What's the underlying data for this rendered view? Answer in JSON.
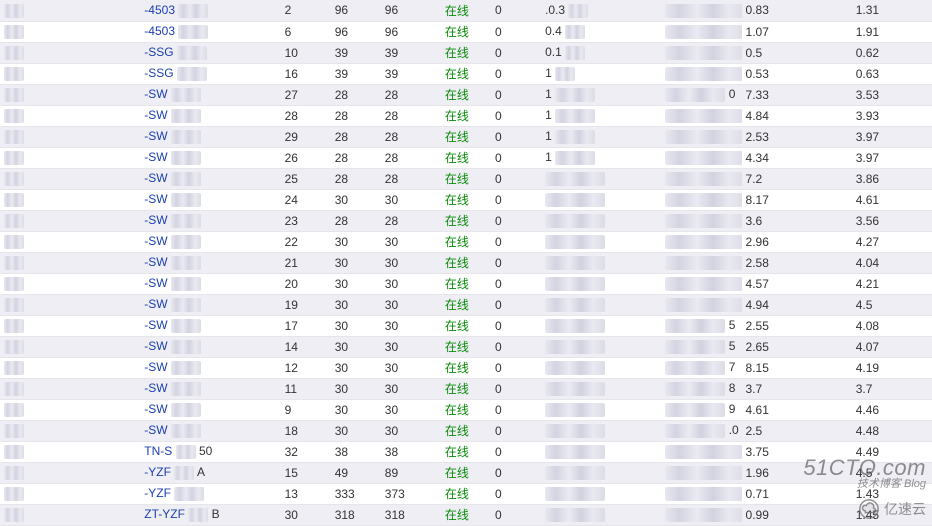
{
  "status_label": "在线",
  "watermarks": {
    "cto_big": "51CTO.com",
    "cto_small": "技术博客  Blog",
    "yisu": "亿速云"
  },
  "rows": [
    {
      "name_vis": "-4503",
      "name_blur_w": "w30",
      "c2": "2",
      "c3": "96",
      "c4": "96",
      "c6": "0",
      "c7_vis": ".0.3",
      "c7_blur_w": "w20",
      "c8_vis": "",
      "c8_blur_w": "w80",
      "c9": "0.83",
      "c10": "1.31"
    },
    {
      "name_vis": "-4503",
      "name_blur_w": "w30",
      "c2": "6",
      "c3": "96",
      "c4": "96",
      "c6": "0",
      "c7_vis": "0.4",
      "c7_blur_w": "w20",
      "c8_vis": "",
      "c8_blur_w": "w80",
      "c9": "1.07",
      "c10": "1.91"
    },
    {
      "name_vis": "-SSG",
      "name_blur_w": "w30",
      "c2": "10",
      "c3": "39",
      "c4": "39",
      "c6": "0",
      "c7_vis": "0.1",
      "c7_blur_w": "w20",
      "c8_vis": "",
      "c8_blur_w": "w80",
      "c9": "0.5",
      "c10": "0.62"
    },
    {
      "name_vis": "-SSG",
      "name_blur_w": "w30",
      "c2": "16",
      "c3": "39",
      "c4": "39",
      "c6": "0",
      "c7_vis": "1",
      "c7_blur_w": "w20",
      "c8_vis": "",
      "c8_blur_w": "w80",
      "c9": "0.53",
      "c10": "0.63"
    },
    {
      "name_vis": "-SW",
      "name_blur_w": "w30",
      "c2": "27",
      "c3": "28",
      "c4": "28",
      "c6": "0",
      "c7_vis": "1",
      "c7_blur_w": "w40",
      "c8_vis": "0",
      "c8_blur_w": "w60",
      "c9": "7.33",
      "c10": "3.53"
    },
    {
      "name_vis": "-SW",
      "name_blur_w": "w30",
      "c2": "28",
      "c3": "28",
      "c4": "28",
      "c6": "0",
      "c7_vis": "1",
      "c7_blur_w": "w40",
      "c8_vis": "",
      "c8_blur_w": "w80",
      "c9": "4.84",
      "c10": "3.93"
    },
    {
      "name_vis": "-SW",
      "name_blur_w": "w30",
      "c2": "29",
      "c3": "28",
      "c4": "28",
      "c6": "0",
      "c7_vis": "1",
      "c7_blur_w": "w40",
      "c8_vis": "",
      "c8_blur_w": "w80",
      "c9": "2.53",
      "c10": "3.97"
    },
    {
      "name_vis": "-SW",
      "name_blur_w": "w30",
      "c2": "26",
      "c3": "28",
      "c4": "28",
      "c6": "0",
      "c7_vis": "1",
      "c7_blur_w": "w40",
      "c8_vis": "",
      "c8_blur_w": "w80",
      "c9": "4.34",
      "c10": "3.97"
    },
    {
      "name_vis": "-SW",
      "name_blur_w": "w30",
      "c2": "25",
      "c3": "28",
      "c4": "28",
      "c6": "0",
      "c7_vis": "",
      "c7_blur_w": "w60",
      "c8_vis": "",
      "c8_blur_w": "w80",
      "c9": "7.2",
      "c10": "3.86"
    },
    {
      "name_vis": "-SW",
      "name_blur_w": "w30",
      "c2": "24",
      "c3": "30",
      "c4": "30",
      "c6": "0",
      "c7_vis": "",
      "c7_blur_w": "w60",
      "c8_vis": "",
      "c8_blur_w": "w80",
      "c9": "8.17",
      "c10": "4.61"
    },
    {
      "name_vis": "-SW",
      "name_blur_w": "w30",
      "c2": "23",
      "c3": "28",
      "c4": "28",
      "c6": "0",
      "c7_vis": "",
      "c7_blur_w": "w60",
      "c8_vis": "",
      "c8_blur_w": "w80",
      "c9": "3.6",
      "c10": "3.56"
    },
    {
      "name_vis": "-SW",
      "name_blur_w": "w30",
      "c2": "22",
      "c3": "30",
      "c4": "30",
      "c6": "0",
      "c7_vis": "",
      "c7_blur_w": "w60",
      "c8_vis": "",
      "c8_blur_w": "w80",
      "c9": "2.96",
      "c10": "4.27"
    },
    {
      "name_vis": "-SW",
      "name_blur_w": "w30",
      "c2": "21",
      "c3": "30",
      "c4": "30",
      "c6": "0",
      "c7_vis": "",
      "c7_blur_w": "w60",
      "c8_vis": "",
      "c8_blur_w": "w80",
      "c9": "2.58",
      "c10": "4.04"
    },
    {
      "name_vis": "-SW",
      "name_blur_w": "w30",
      "c2": "20",
      "c3": "30",
      "c4": "30",
      "c6": "0",
      "c7_vis": "",
      "c7_blur_w": "w60",
      "c8_vis": "",
      "c8_blur_w": "w80",
      "c9": "4.57",
      "c10": "4.21"
    },
    {
      "name_vis": "-SW",
      "name_blur_w": "w30",
      "c2": "19",
      "c3": "30",
      "c4": "30",
      "c6": "0",
      "c7_vis": "",
      "c7_blur_w": "w60",
      "c8_vis": "",
      "c8_blur_w": "w80",
      "c9": "4.94",
      "c10": "4.5"
    },
    {
      "name_vis": "-SW",
      "name_blur_w": "w30",
      "c2": "17",
      "c3": "30",
      "c4": "30",
      "c6": "0",
      "c7_vis": "",
      "c7_blur_w": "w60",
      "c8_vis": "5",
      "c8_blur_w": "w60",
      "c9": "2.55",
      "c10": "4.08"
    },
    {
      "name_vis": "-SW",
      "name_blur_w": "w30",
      "c2": "14",
      "c3": "30",
      "c4": "30",
      "c6": "0",
      "c7_vis": "",
      "c7_blur_w": "w60",
      "c8_vis": "5",
      "c8_blur_w": "w60",
      "c9": "2.65",
      "c10": "4.07"
    },
    {
      "name_vis": "-SW",
      "name_blur_w": "w30",
      "c2": "12",
      "c3": "30",
      "c4": "30",
      "c6": "0",
      "c7_vis": "",
      "c7_blur_w": "w60",
      "c8_vis": "7",
      "c8_blur_w": "w60",
      "c9": "8.15",
      "c10": "4.19"
    },
    {
      "name_vis": "-SW",
      "name_blur_w": "w30",
      "c2": "11",
      "c3": "30",
      "c4": "30",
      "c6": "0",
      "c7_vis": "",
      "c7_blur_w": "w60",
      "c8_vis": "8",
      "c8_blur_w": "w60",
      "c9": "3.7",
      "c10": "3.7"
    },
    {
      "name_vis": "-SW",
      "name_blur_w": "w30",
      "c2": "9",
      "c3": "30",
      "c4": "30",
      "c6": "0",
      "c7_vis": "",
      "c7_blur_w": "w60",
      "c8_vis": "9",
      "c8_blur_w": "w60",
      "c9": "4.61",
      "c10": "4.46"
    },
    {
      "name_vis": "-SW",
      "name_blur_w": "w30",
      "c2": "18",
      "c3": "30",
      "c4": "30",
      "c6": "0",
      "c7_vis": "",
      "c7_blur_w": "w60",
      "c8_vis": ".0",
      "c8_blur_w": "w60",
      "c9": "2.5",
      "c10": "4.48"
    },
    {
      "name_vis": "TN-S",
      "name_blur_w": "w20",
      "name_suffix": "50",
      "c2": "32",
      "c3": "38",
      "c4": "38",
      "c6": "0",
      "c7_vis": "",
      "c7_blur_w": "w60",
      "c8_vis": "",
      "c8_blur_w": "w80",
      "c9": "3.75",
      "c10": "4.49"
    },
    {
      "name_vis": "-YZF",
      "name_blur_w": "w20",
      "name_suffix": "A",
      "c2": "15",
      "c3": "49",
      "c4": "89",
      "c6": "0",
      "c7_vis": "",
      "c7_blur_w": "w60",
      "c8_vis": "",
      "c8_blur_w": "w80",
      "c9": "1.96",
      "c10": "4.5"
    },
    {
      "name_vis": "-YZF",
      "name_blur_w": "w30",
      "c2": "13",
      "c3": "333",
      "c4": "373",
      "c6": "0",
      "c7_vis": "",
      "c7_blur_w": "w60",
      "c8_vis": "",
      "c8_blur_w": "w80",
      "c9": "0.71",
      "c10": "1.43"
    },
    {
      "name_vis": "ZT-YZF",
      "name_blur_w": "w20",
      "name_suffix": "B",
      "c2": "30",
      "c3": "318",
      "c4": "318",
      "c6": "0",
      "c7_vis": "",
      "c7_blur_w": "w60",
      "c8_vis": "",
      "c8_blur_w": "w80",
      "c9": "0.99",
      "c10": "1.45"
    }
  ]
}
